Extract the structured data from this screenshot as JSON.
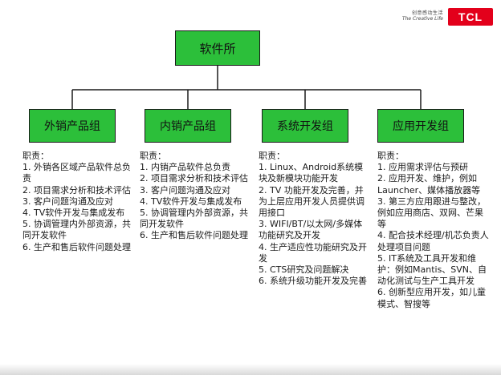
{
  "brand": {
    "tagline_cn": "创意感动生活",
    "tagline_en": "The Creative Life",
    "logo": "TCL",
    "logo_color": "#e3001b"
  },
  "colors": {
    "box_fill": "#2cbf3a",
    "line": "#1a1a1a"
  },
  "org": {
    "root": "软件所",
    "groups": [
      {
        "name": "外销产品组",
        "duty_title": "职责：",
        "duties": [
          "1. 外销各区域产品软件总负责",
          "2. 项目需求分析和技术评估",
          "3. 客户问题沟通及应对",
          "4. TV软件开发与集成发布",
          "5. 协调管理内外部资源，共同开发软件",
          "6. 生产和售后软件问题处理"
        ]
      },
      {
        "name": "内销产品组",
        "duty_title": "职责：",
        "duties": [
          "1. 内销产品软件总负责",
          "2. 项目需求分析和技术评估",
          "3. 客户问题沟通及应对",
          "4. TV软件开发与集成发布",
          "5. 协调管理内外部资源，共同开发软件",
          "6. 生产和售后软件问题处理"
        ]
      },
      {
        "name": "系统开发组",
        "duty_title": "职责：",
        "duties": [
          "1. Linux、Android系统模块及新模块功能开发",
          "2. TV 功能开发及完善，并为上层应用开发人员提供调用接口",
          "3. WIFI/BT/以太网/多媒体功能研究及开发",
          "4. 生产适应性功能研究及开发",
          "5. CTS研究及问题解决",
          "6. 系统升级功能开发及完善"
        ]
      },
      {
        "name": "应用开发组",
        "duty_title": "职责：",
        "duties": [
          "1. 应用需求评估与预研",
          "2. 应用开发、维护，例如Launcher、媒体播放器等",
          "3. 第三方应用跟进与整改，例如应用商店、双网、芒果等",
          "4. 配合技术经理/机芯负责人处理项目问题",
          "5. IT系统及工具开发和维护：例如Mantis、SVN、自动化测试与生产工具开发",
          "6. 创新型应用开发，如儿童模式、智搜等"
        ]
      }
    ]
  }
}
